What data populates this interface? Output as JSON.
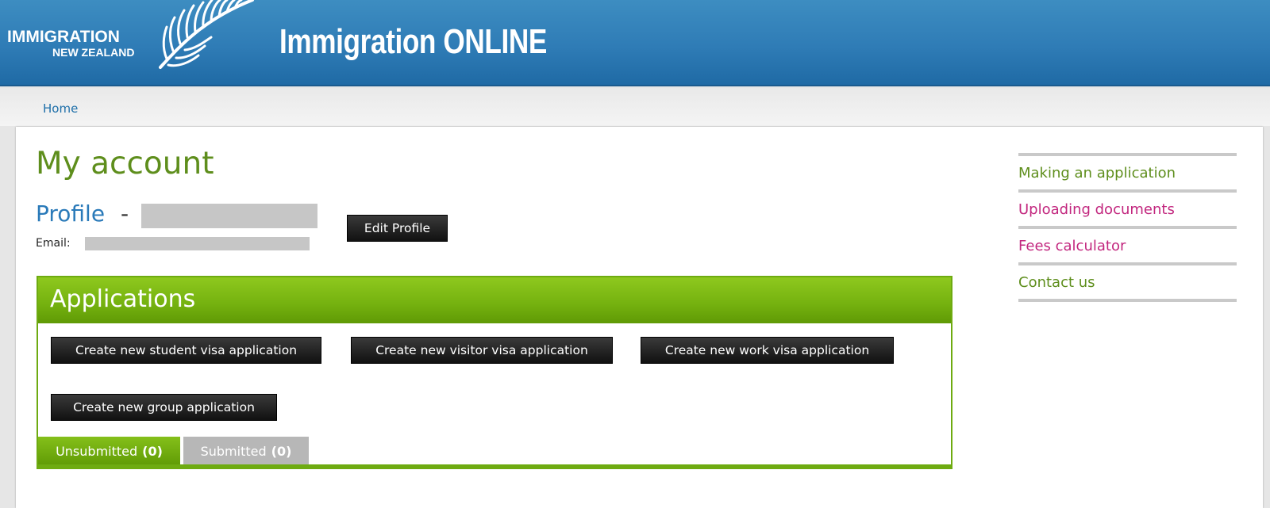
{
  "header": {
    "logo_line1": "IMMIGRATION",
    "logo_line2": "NEW ZEALAND",
    "site_title": "Immigration ONLINE"
  },
  "breadcrumb": {
    "home": "Home"
  },
  "main": {
    "page_title": "My account",
    "profile_label": "Profile",
    "profile_separator": "-",
    "email_label": "Email:",
    "edit_profile_label": "Edit Profile"
  },
  "applications": {
    "title": "Applications",
    "buttons": {
      "student": "Create new student visa application",
      "visitor": "Create new visitor visa application",
      "work": "Create new work visa application",
      "group": "Create new group application"
    },
    "tabs": [
      {
        "label": "Unsubmitted",
        "count": "(0)",
        "active": true
      },
      {
        "label": "Submitted",
        "count": "(0)",
        "active": false
      }
    ]
  },
  "sidenav": {
    "items": [
      {
        "label": "Making an application",
        "color": "#5e8e1c"
      },
      {
        "label": "Uploading documents",
        "color": "#c2267e"
      },
      {
        "label": "Fees calculator",
        "color": "#c2267e"
      },
      {
        "label": "Contact us",
        "color": "#5e8e1c"
      }
    ]
  },
  "colors": {
    "header_blue": "#2f7cb6",
    "brand_green": "#74b10f",
    "link_magenta": "#c2267e"
  }
}
